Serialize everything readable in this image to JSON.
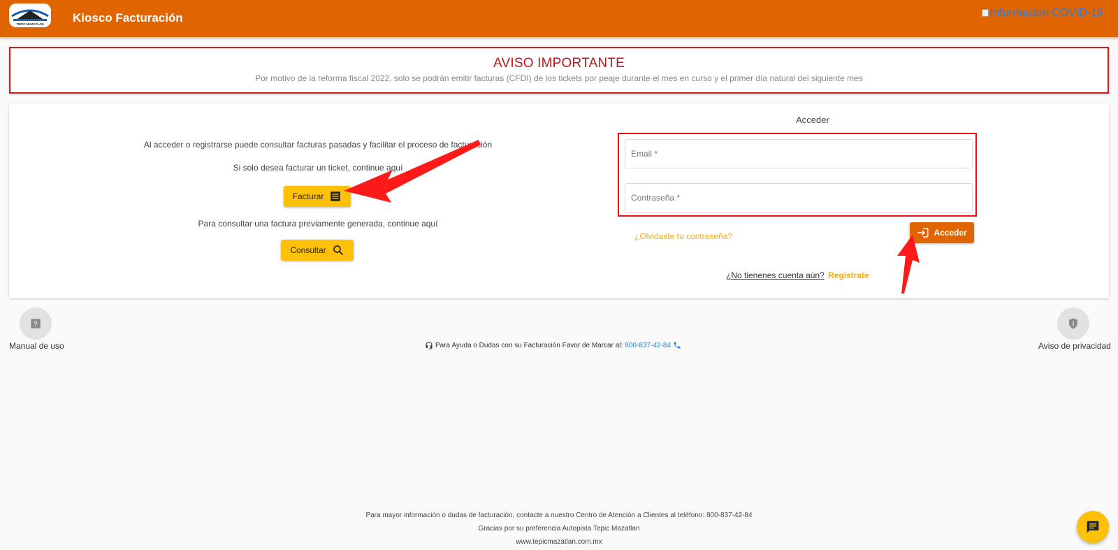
{
  "header": {
    "app_title": "Kiosco Facturación",
    "logo_text": "TEPIC MAZATLAN",
    "covid_alt": "Información COVID-19"
  },
  "notice": {
    "title": "AVISO IMPORTANTE",
    "text": "Por motivo de la reforma fiscal 2022, solo se podrán emitir facturas (CFDI) de los tickets por peaje durante el mes en curso y el primer día natural del siguiente mes"
  },
  "left": {
    "intro": "Al acceder o registrarse puede consultar facturas pasadas y facilitar el proceso de facturación",
    "ticket_text": "Si solo desea facturar un ticket, continue aquí",
    "facturar_label": "Facturar",
    "consult_text": "Para consultar una factura previamente generada, continue aquí",
    "consultar_label": "Consultar"
  },
  "login": {
    "title": "Acceder",
    "email_placeholder": "Email *",
    "password_placeholder": "Contraseña *",
    "forgot_label": "¿Olvidaste tu contraseña?",
    "submit_label": "Acceder",
    "no_account_label": "¿No tienenes cuenta aún?",
    "register_label": "Registrate"
  },
  "help": {
    "manual_label": "Manual de uso",
    "privacy_label": "Aviso de privacidad",
    "help_text": "Para Ayuda o Dudas con su Facturación Favor de Marcar al:",
    "help_phone": "800-837-42-84"
  },
  "footer": {
    "line1": "Para mayor información o dudas de facturación, contacte a nuestro Centro de Atención a Clientes al teléfono: 800-837-42-84",
    "line2": "Gracias por su preferencia Autopista Tepic Mazatlan",
    "line3": "www.tepicmazatlan.com.mx"
  },
  "colors": {
    "brand_orange": "#e06500",
    "accent_yellow": "#ffc107",
    "alert_red": "#c0161a"
  }
}
